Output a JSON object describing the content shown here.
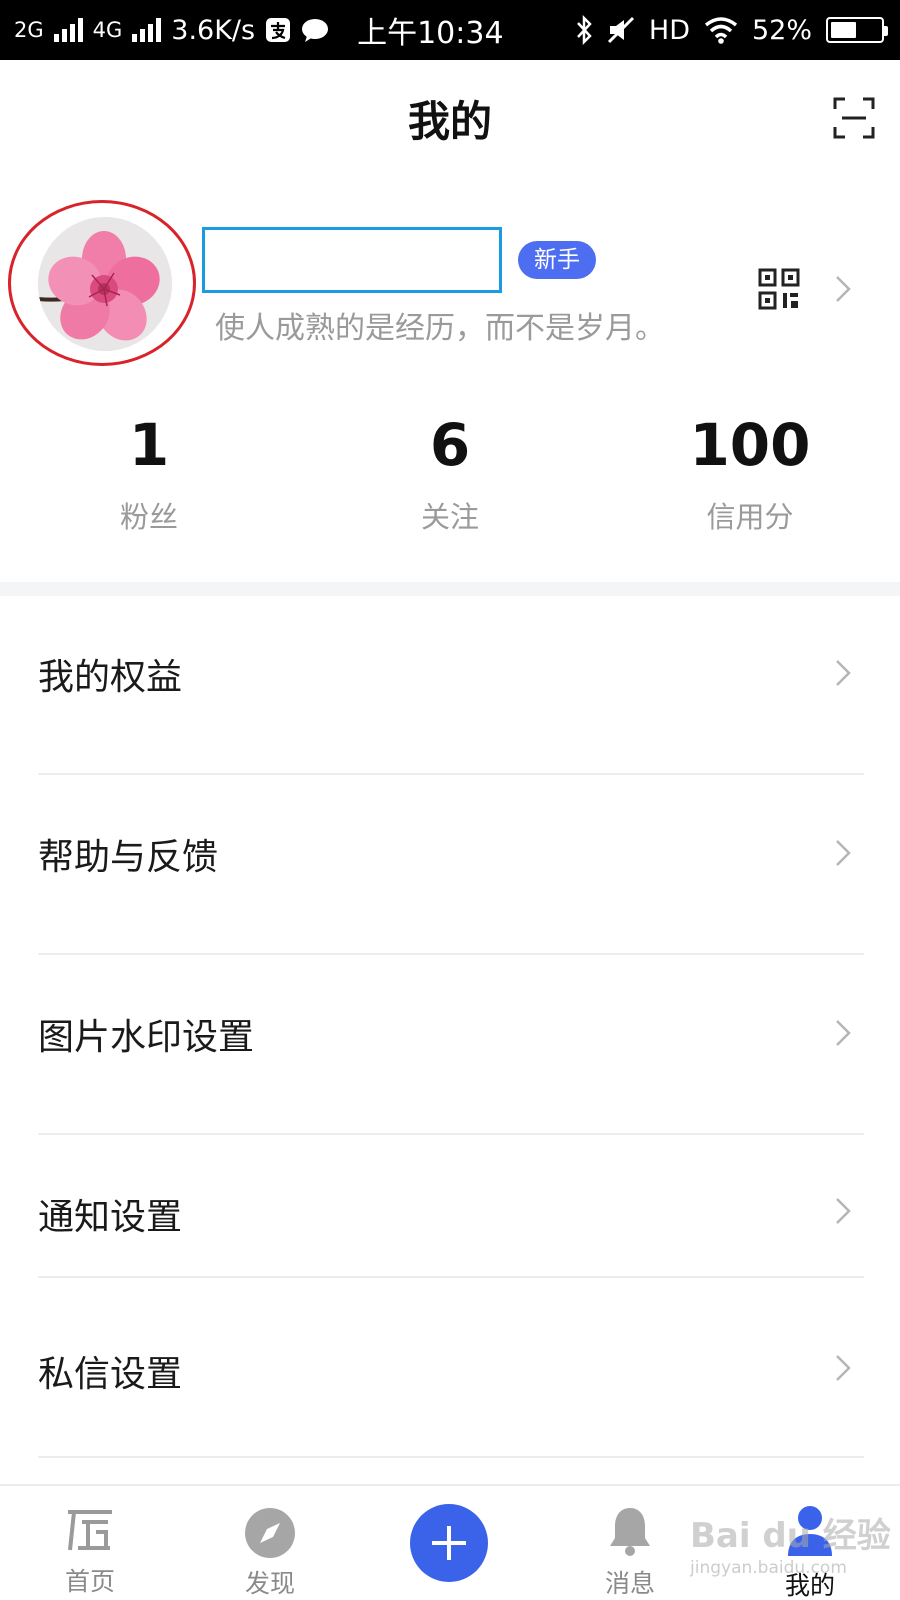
{
  "status_bar": {
    "net1": "2G",
    "net2": "4G",
    "speed": "3.6K/s",
    "time": "上午10:34",
    "hd": "HD",
    "battery": "52%",
    "battery_level": 0.52
  },
  "header": {
    "title": "我的"
  },
  "profile": {
    "name": "",
    "badge": "新手",
    "bio": "使人成熟的是经历，而不是岁月。"
  },
  "stats": [
    {
      "value": "1",
      "label": "粉丝"
    },
    {
      "value": "6",
      "label": "关注"
    },
    {
      "value": "100",
      "label": "信用分"
    }
  ],
  "menu": [
    {
      "label": "我的权益"
    },
    {
      "label": "帮助与反馈"
    },
    {
      "label": "图片水印设置"
    },
    {
      "label": "通知设置"
    },
    {
      "label": "私信设置"
    }
  ],
  "tabs": [
    {
      "label": "首页",
      "icon": "home-icon"
    },
    {
      "label": "发现",
      "icon": "compass-icon"
    },
    {
      "label": "",
      "icon": "plus-icon"
    },
    {
      "label": "消息",
      "icon": "bell-icon"
    },
    {
      "label": "我的",
      "icon": "user-icon",
      "active": true
    }
  ],
  "watermark": {
    "text": "Bai du 经验",
    "sub": "jingyan.baidu.com"
  },
  "colors": {
    "accent": "#3a63e9",
    "badge": "#4e6ef2",
    "highlight_box": "#1b9ce0",
    "circle_annotation": "#d8232a"
  }
}
